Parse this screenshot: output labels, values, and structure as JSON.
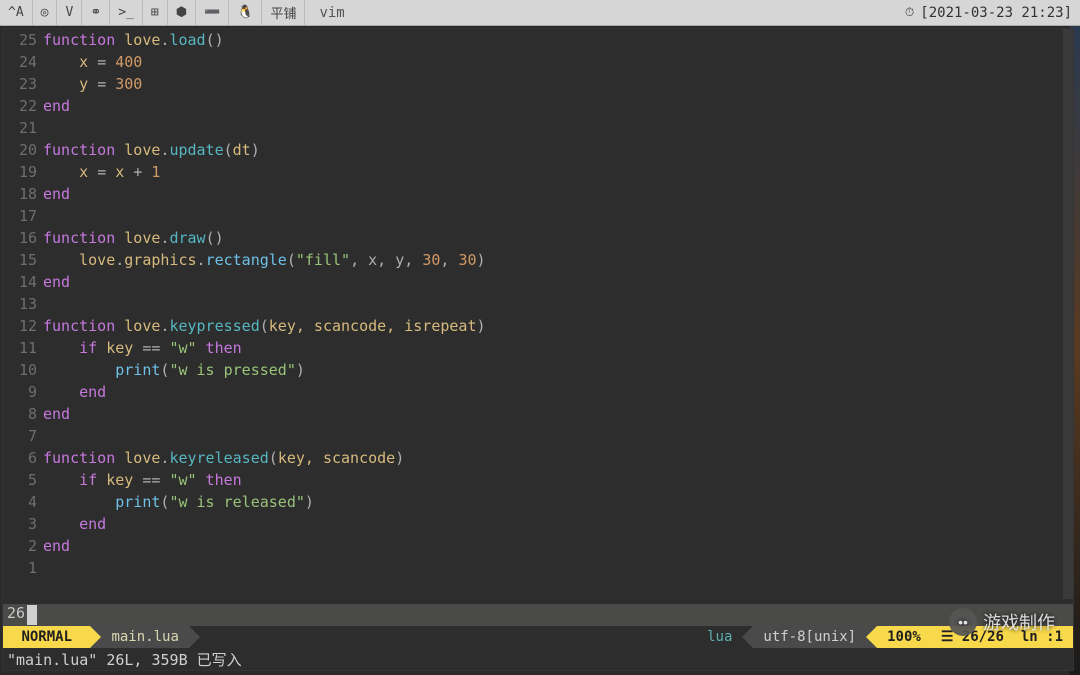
{
  "taskbar": {
    "items": [
      {
        "name": "arch-menu",
        "glyph": "^A"
      },
      {
        "name": "chrome-icon",
        "glyph": "◎"
      },
      {
        "name": "vim-icon",
        "glyph": "V"
      },
      {
        "name": "link-icon",
        "glyph": "⚭"
      },
      {
        "name": "terminal-icon",
        "glyph": ">_"
      },
      {
        "name": "windows-icon",
        "glyph": "⊞"
      },
      {
        "name": "android-icon",
        "glyph": "⬢"
      },
      {
        "name": "eclipse-icon",
        "glyph": "➖"
      },
      {
        "name": "tux-icon",
        "glyph": "🐧"
      },
      {
        "name": "tile-label",
        "glyph": "平铺"
      }
    ],
    "current_app": "vim",
    "clock_icon": "⏱",
    "clock_text": "[2021-03-23 21:23]"
  },
  "editor": {
    "gutter": [
      "25",
      "24",
      "23",
      "22",
      "21",
      "20",
      "19",
      "18",
      "17",
      "16",
      "15",
      "14",
      "13",
      "12",
      "11",
      "10",
      "9",
      "8",
      "7",
      "6",
      "5",
      "4",
      "3",
      "2",
      "1"
    ],
    "lines": [
      [
        {
          "t": "function ",
          "c": "kw"
        },
        {
          "t": "love",
          "c": "id"
        },
        {
          "t": ".",
          "c": "punc"
        },
        {
          "t": "load",
          "c": "fn"
        },
        {
          "t": "()",
          "c": "punc"
        }
      ],
      [
        {
          "t": "    x ",
          "c": "id"
        },
        {
          "t": "= ",
          "c": "op"
        },
        {
          "t": "400",
          "c": "num"
        }
      ],
      [
        {
          "t": "    y ",
          "c": "id"
        },
        {
          "t": "= ",
          "c": "op"
        },
        {
          "t": "300",
          "c": "num"
        }
      ],
      [
        {
          "t": "end",
          "c": "kw"
        }
      ],
      [],
      [
        {
          "t": "function ",
          "c": "kw"
        },
        {
          "t": "love",
          "c": "id"
        },
        {
          "t": ".",
          "c": "punc"
        },
        {
          "t": "update",
          "c": "fn"
        },
        {
          "t": "(",
          "c": "punc"
        },
        {
          "t": "dt",
          "c": "id"
        },
        {
          "t": ")",
          "c": "punc"
        }
      ],
      [
        {
          "t": "    x ",
          "c": "id"
        },
        {
          "t": "= ",
          "c": "op"
        },
        {
          "t": "x ",
          "c": "id"
        },
        {
          "t": "+ ",
          "c": "op"
        },
        {
          "t": "1",
          "c": "num"
        }
      ],
      [
        {
          "t": "end",
          "c": "kw"
        }
      ],
      [],
      [
        {
          "t": "function ",
          "c": "kw"
        },
        {
          "t": "love",
          "c": "id"
        },
        {
          "t": ".",
          "c": "punc"
        },
        {
          "t": "draw",
          "c": "fn"
        },
        {
          "t": "()",
          "c": "punc"
        }
      ],
      [
        {
          "t": "    love",
          "c": "id"
        },
        {
          "t": ".",
          "c": "punc"
        },
        {
          "t": "graphics",
          "c": "id"
        },
        {
          "t": ".",
          "c": "punc"
        },
        {
          "t": "rectangle",
          "c": "fn2"
        },
        {
          "t": "(",
          "c": "punc"
        },
        {
          "t": "\"fill\"",
          "c": "str"
        },
        {
          "t": ", x, y, ",
          "c": "punc"
        },
        {
          "t": "30",
          "c": "num"
        },
        {
          "t": ", ",
          "c": "punc"
        },
        {
          "t": "30",
          "c": "num"
        },
        {
          "t": ")",
          "c": "punc"
        }
      ],
      [
        {
          "t": "end",
          "c": "kw"
        }
      ],
      [],
      [
        {
          "t": "function ",
          "c": "kw"
        },
        {
          "t": "love",
          "c": "id"
        },
        {
          "t": ".",
          "c": "punc"
        },
        {
          "t": "keypressed",
          "c": "fn"
        },
        {
          "t": "(",
          "c": "punc"
        },
        {
          "t": "key, scancode, isrepeat",
          "c": "id"
        },
        {
          "t": ")",
          "c": "punc"
        }
      ],
      [
        {
          "t": "    if ",
          "c": "kw"
        },
        {
          "t": "key ",
          "c": "id"
        },
        {
          "t": "== ",
          "c": "op"
        },
        {
          "t": "\"w\"",
          "c": "str"
        },
        {
          "t": " then",
          "c": "kw"
        }
      ],
      [
        {
          "t": "        print",
          "c": "fn2"
        },
        {
          "t": "(",
          "c": "punc"
        },
        {
          "t": "\"w is pressed\"",
          "c": "str"
        },
        {
          "t": ")",
          "c": "punc"
        }
      ],
      [
        {
          "t": "    end",
          "c": "kw"
        }
      ],
      [
        {
          "t": "end",
          "c": "kw"
        }
      ],
      [],
      [
        {
          "t": "function ",
          "c": "kw"
        },
        {
          "t": "love",
          "c": "id"
        },
        {
          "t": ".",
          "c": "punc"
        },
        {
          "t": "keyreleased",
          "c": "fn"
        },
        {
          "t": "(",
          "c": "punc"
        },
        {
          "t": "key, scancode",
          "c": "id"
        },
        {
          "t": ")",
          "c": "punc"
        }
      ],
      [
        {
          "t": "    if ",
          "c": "kw"
        },
        {
          "t": "key ",
          "c": "id"
        },
        {
          "t": "== ",
          "c": "op"
        },
        {
          "t": "\"w\"",
          "c": "str"
        },
        {
          "t": " then",
          "c": "kw"
        }
      ],
      [
        {
          "t": "        print",
          "c": "fn2"
        },
        {
          "t": "(",
          "c": "punc"
        },
        {
          "t": "\"w is released\"",
          "c": "str"
        },
        {
          "t": ")",
          "c": "punc"
        }
      ],
      [
        {
          "t": "    end",
          "c": "kw"
        }
      ],
      [
        {
          "t": "end",
          "c": "kw"
        }
      ],
      []
    ],
    "cursor_line_number": "26"
  },
  "statusline": {
    "mode": "NORMAL",
    "filename": "main.lua",
    "filetype": "lua",
    "encoding": "utf-8[unix]",
    "percent": "100%",
    "lines_icon": "☰",
    "lines": "26/26",
    "col_icon": "ln :",
    "col": "1"
  },
  "cmdline": "\"main.lua\" 26L, 359B 已写入",
  "watermark": {
    "icon": "••",
    "text": "游戏制作"
  }
}
